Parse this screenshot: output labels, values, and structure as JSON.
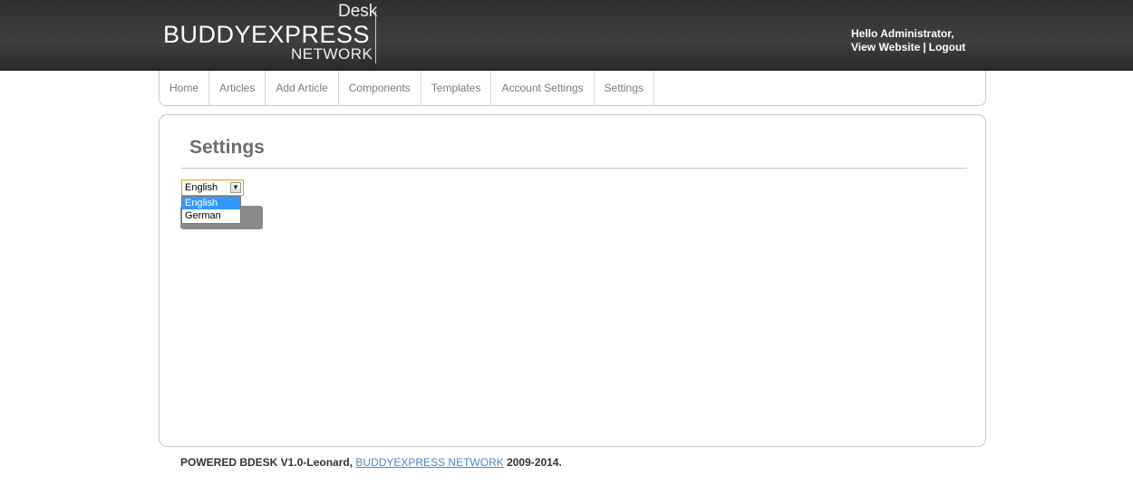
{
  "header": {
    "logo": {
      "desk": "Desk",
      "main": "BUDDYEXPRESS",
      "network": "NETWORK"
    },
    "greeting": "Hello Administrator,",
    "links": {
      "view_website": "View Website",
      "separator": "|",
      "logout": "Logout"
    }
  },
  "nav": {
    "items": [
      {
        "label": "Home"
      },
      {
        "label": "Articles"
      },
      {
        "label": "Add Article"
      },
      {
        "label": "Components"
      },
      {
        "label": "Templates"
      },
      {
        "label": "Account Settings"
      },
      {
        "label": "Settings"
      }
    ]
  },
  "main": {
    "title": "Settings",
    "language_select": {
      "value": "English",
      "options": [
        "English",
        "German"
      ],
      "highlighted": "English"
    }
  },
  "footer": {
    "prefix": "POWERED BDESK V1.0-Leonard,",
    "brand": "BUDDYEXPRESS NETWORK",
    "suffix": "2009-2014."
  },
  "colors": {
    "header_bg": "#333333",
    "link_blue": "#4c86c2",
    "select_highlight": "#3399ff",
    "select_focus_border": "#e5a100"
  }
}
